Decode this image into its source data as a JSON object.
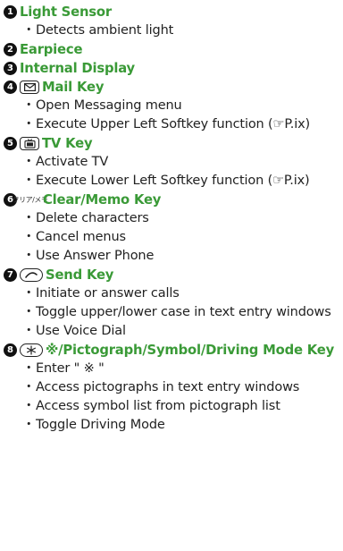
{
  "items": [
    {
      "num": "1",
      "title": "Light Sensor",
      "bullets": [
        "Detects ambient light"
      ]
    },
    {
      "num": "2",
      "title": "Earpiece",
      "bullets": []
    },
    {
      "num": "3",
      "title": "Internal Display",
      "bullets": []
    },
    {
      "num": "4",
      "title": "Mail Key",
      "icon": "mail-key-icon",
      "bullets": [
        "Open Messaging menu",
        "Execute Upper Left Softkey function (☞P.ix)"
      ]
    },
    {
      "num": "5",
      "title": "TV Key",
      "icon": "tv-key-icon",
      "bullets": [
        "Activate TV",
        "Execute Lower Left Softkey function (☞P.ix)"
      ]
    },
    {
      "num": "6",
      "title": "Clear/Memo Key",
      "icon": "clear-memo-key-icon",
      "icon_text": "クリア/メモ",
      "bullets": [
        "Delete characters",
        "Cancel menus",
        "Use Answer Phone"
      ]
    },
    {
      "num": "7",
      "title": "Send Key",
      "icon": "send-key-icon",
      "bullets": [
        "Initiate or answer calls",
        "Toggle upper/lower case in text entry windows",
        "Use Voice Dial"
      ]
    },
    {
      "num": "8",
      "title": "※/Pictograph/Symbol/Driving Mode Key",
      "icon": "asterisk-key-icon",
      "bullets": [
        "Enter \" ※ \"",
        "Access pictographs in text entry windows",
        "Access symbol list from pictograph list",
        "Toggle Driving Mode"
      ]
    }
  ],
  "bullet_mark": "・",
  "accent_color": "#3a9a37"
}
